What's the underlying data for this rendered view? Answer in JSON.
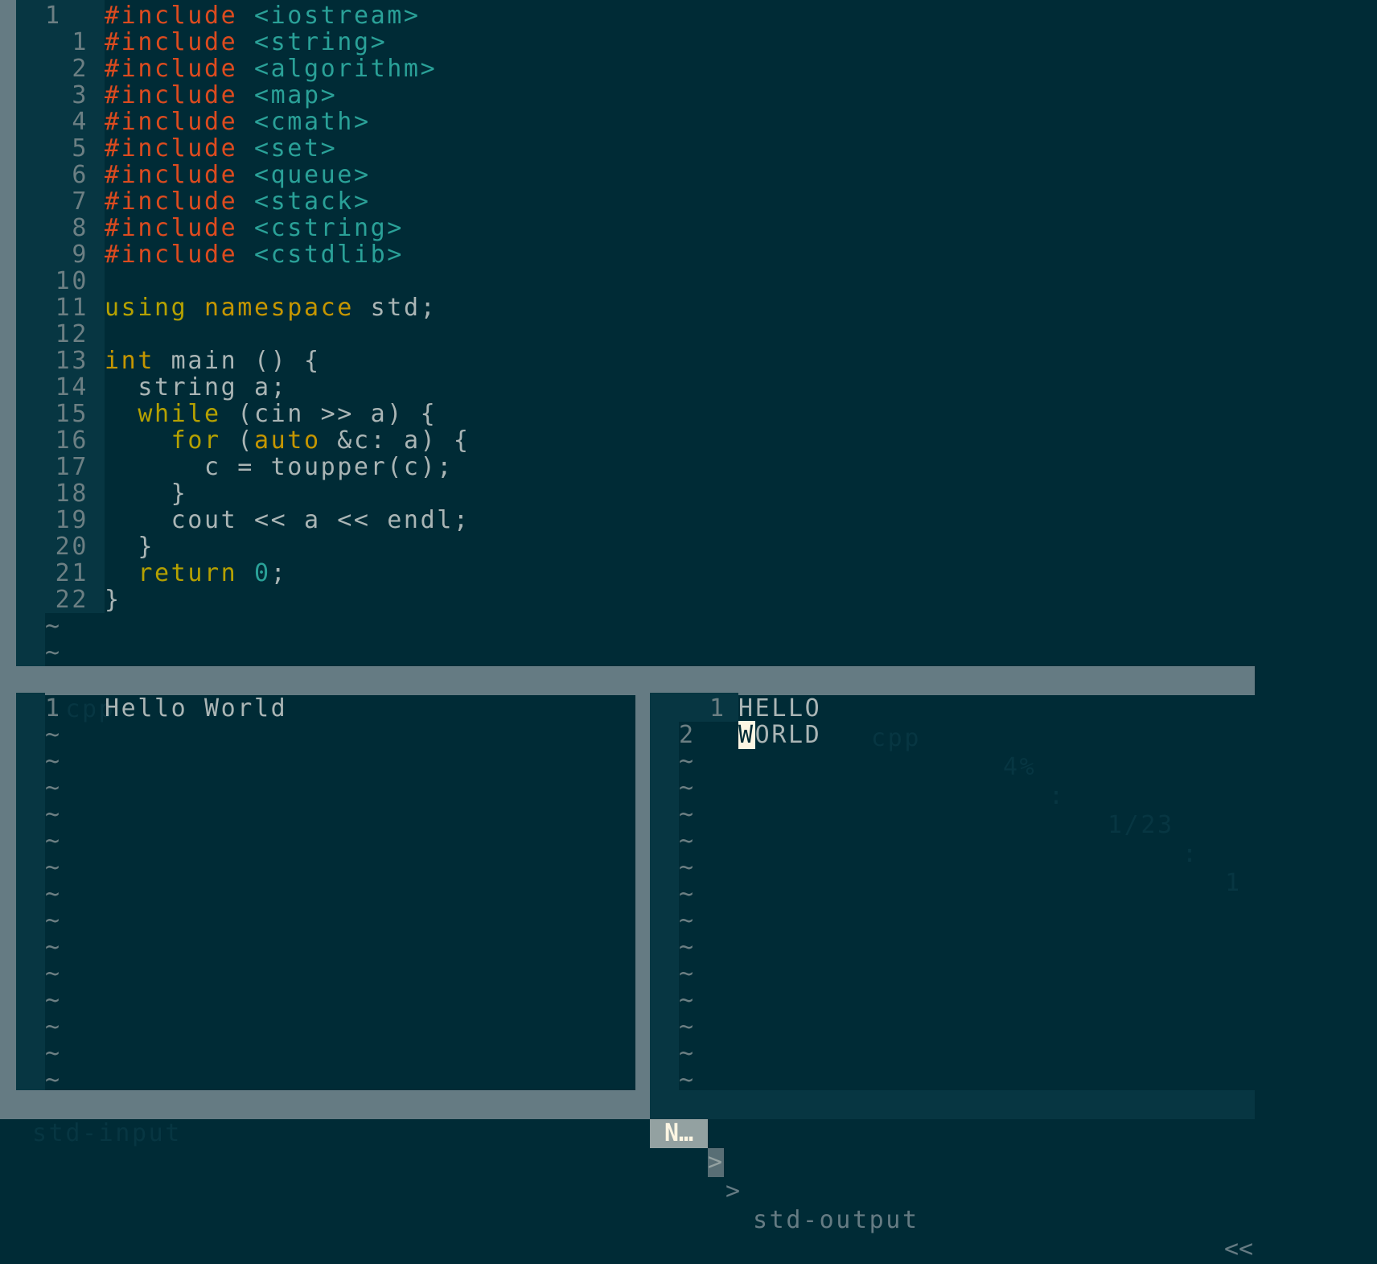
{
  "editor": {
    "first_line_number": "1",
    "lines": [
      {
        "n": "1",
        "tokens": [
          {
            "t": "#include",
            "c": "pre"
          },
          {
            "t": " ",
            "c": "id"
          },
          {
            "t": "<string>",
            "c": "str"
          }
        ]
      },
      {
        "n": "2",
        "tokens": [
          {
            "t": "#include",
            "c": "pre"
          },
          {
            "t": " ",
            "c": "id"
          },
          {
            "t": "<algorithm>",
            "c": "str"
          }
        ]
      },
      {
        "n": "3",
        "tokens": [
          {
            "t": "#include",
            "c": "pre"
          },
          {
            "t": " ",
            "c": "id"
          },
          {
            "t": "<map>",
            "c": "str"
          }
        ]
      },
      {
        "n": "4",
        "tokens": [
          {
            "t": "#include",
            "c": "pre"
          },
          {
            "t": " ",
            "c": "id"
          },
          {
            "t": "<cmath>",
            "c": "str"
          }
        ]
      },
      {
        "n": "5",
        "tokens": [
          {
            "t": "#include",
            "c": "pre"
          },
          {
            "t": " ",
            "c": "id"
          },
          {
            "t": "<set>",
            "c": "str"
          }
        ]
      },
      {
        "n": "6",
        "tokens": [
          {
            "t": "#include",
            "c": "pre"
          },
          {
            "t": " ",
            "c": "id"
          },
          {
            "t": "<queue>",
            "c": "str"
          }
        ]
      },
      {
        "n": "7",
        "tokens": [
          {
            "t": "#include",
            "c": "pre"
          },
          {
            "t": " ",
            "c": "id"
          },
          {
            "t": "<stack>",
            "c": "str"
          }
        ]
      },
      {
        "n": "8",
        "tokens": [
          {
            "t": "#include",
            "c": "pre"
          },
          {
            "t": " ",
            "c": "id"
          },
          {
            "t": "<cstring>",
            "c": "str"
          }
        ]
      },
      {
        "n": "9",
        "tokens": [
          {
            "t": "#include",
            "c": "pre"
          },
          {
            "t": " ",
            "c": "id"
          },
          {
            "t": "<cstdlib>",
            "c": "str"
          }
        ]
      },
      {
        "n": "10",
        "tokens": []
      },
      {
        "n": "11",
        "tokens": [
          {
            "t": "using",
            "c": "kw"
          },
          {
            "t": " ",
            "c": "id"
          },
          {
            "t": "namespace",
            "c": "type"
          },
          {
            "t": " std;",
            "c": "id"
          }
        ]
      },
      {
        "n": "12",
        "tokens": []
      },
      {
        "n": "13",
        "tokens": [
          {
            "t": "int",
            "c": "type"
          },
          {
            "t": " main () {",
            "c": "id"
          }
        ]
      },
      {
        "n": "14",
        "tokens": [
          {
            "t": "  string a;",
            "c": "id"
          }
        ]
      },
      {
        "n": "15",
        "tokens": [
          {
            "t": "  ",
            "c": "id"
          },
          {
            "t": "while",
            "c": "kw"
          },
          {
            "t": " (cin >> a) {",
            "c": "id"
          }
        ]
      },
      {
        "n": "16",
        "tokens": [
          {
            "t": "    ",
            "c": "id"
          },
          {
            "t": "for",
            "c": "kw"
          },
          {
            "t": " (",
            "c": "id"
          },
          {
            "t": "auto",
            "c": "type"
          },
          {
            "t": " &c: a) {",
            "c": "id"
          }
        ]
      },
      {
        "n": "17",
        "tokens": [
          {
            "t": "      c = toupper(c);",
            "c": "id"
          }
        ]
      },
      {
        "n": "18",
        "tokens": [
          {
            "t": "    }",
            "c": "id"
          }
        ]
      },
      {
        "n": "19",
        "tokens": [
          {
            "t": "    cout << a << endl;",
            "c": "id"
          }
        ]
      },
      {
        "n": "20",
        "tokens": [
          {
            "t": "  }",
            "c": "id"
          }
        ]
      },
      {
        "n": "21",
        "tokens": [
          {
            "t": "  ",
            "c": "id"
          },
          {
            "t": "return",
            "c": "kw"
          },
          {
            "t": " ",
            "c": "id"
          },
          {
            "t": "0",
            "c": "num"
          },
          {
            "t": ";",
            "c": "id"
          }
        ]
      },
      {
        "n": "22",
        "tokens": [
          {
            "t": "}",
            "c": "id"
          }
        ]
      }
    ],
    "first_line_tokens": [
      {
        "t": "#include",
        "c": "pre"
      },
      {
        "t": " ",
        "c": "id"
      },
      {
        "t": "<iostream>",
        "c": "str"
      }
    ],
    "tilde": "~"
  },
  "status_top": {
    "filename": "a.cpp",
    "filetype": "cpp",
    "percent": "4%",
    "sep1": ":",
    "position": "1/23",
    "sep2": ":",
    "column": "1"
  },
  "input_pane": {
    "line_number": "1",
    "text": "Hello World",
    "tilde": "~"
  },
  "output_pane": {
    "lines": [
      {
        "n": "1",
        "text": "HELLO"
      },
      {
        "n": "2",
        "cursor_char": "W",
        "text": "ORLD"
      }
    ],
    "tilde": "~"
  },
  "status_bottom": {
    "left_name": "std-input",
    "mode": "N…",
    "arrow1": ">",
    "arrow2": ">",
    "right_name": "std-output",
    "right_arrows": "<<"
  }
}
